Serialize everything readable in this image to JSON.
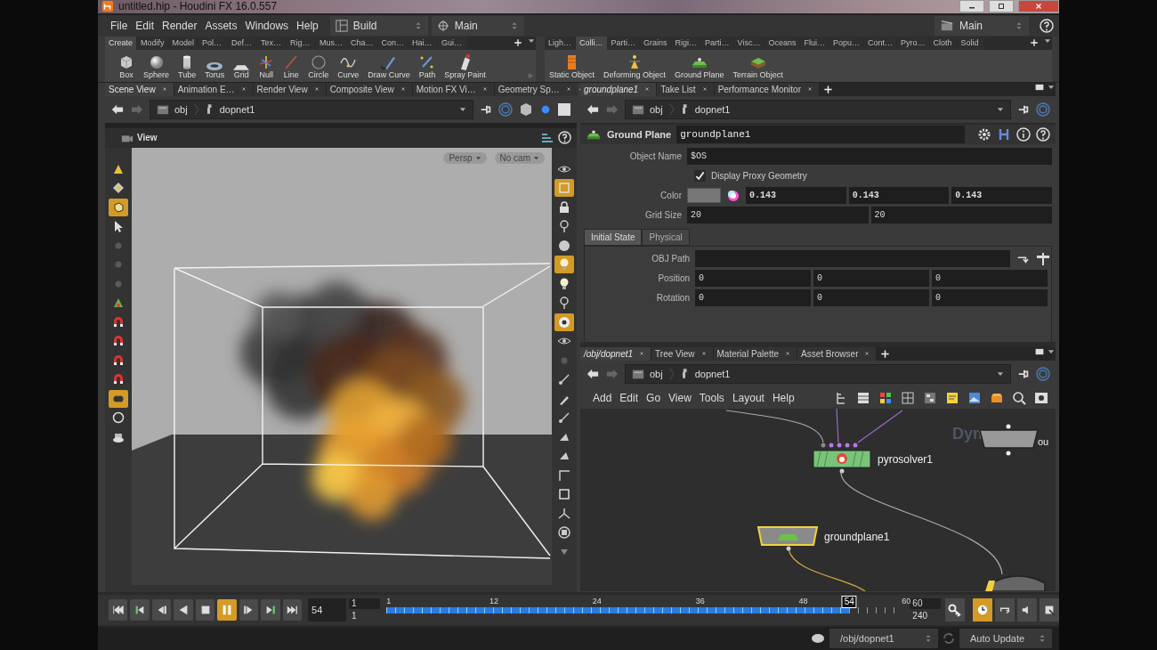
{
  "window": {
    "title": "untitled.hip - Houdini FX 16.0.557"
  },
  "menu": [
    "File",
    "Edit",
    "Render",
    "Assets",
    "Windows",
    "Help"
  ],
  "desktop": "Build",
  "viewport_layout": "Main",
  "right_layout": "Main",
  "shelf_left": {
    "tabs": [
      {
        "label": "Create",
        "selected": true
      },
      {
        "label": "Modify",
        "selected": false
      },
      {
        "label": "Model",
        "selected": false
      },
      {
        "label": "Pol…",
        "selected": false
      },
      {
        "label": "Def…",
        "selected": false
      },
      {
        "label": "Tex…",
        "selected": false
      },
      {
        "label": "Rig…",
        "selected": false
      },
      {
        "label": "Mus…",
        "selected": false
      },
      {
        "label": "Cha…",
        "selected": false
      },
      {
        "label": "Con…",
        "selected": false
      },
      {
        "label": "Hai…",
        "selected": false
      },
      {
        "label": "Gui…",
        "selected": false
      }
    ],
    "tools": [
      {
        "label": "Box",
        "kind": "box"
      },
      {
        "label": "Sphere",
        "kind": "sphere"
      },
      {
        "label": "Tube",
        "kind": "tube"
      },
      {
        "label": "Torus",
        "kind": "torus"
      },
      {
        "label": "Grid",
        "kind": "grid"
      },
      {
        "label": "Null",
        "kind": "null"
      },
      {
        "label": "Line",
        "kind": "line"
      },
      {
        "label": "Circle",
        "kind": "circle"
      },
      {
        "label": "Curve",
        "kind": "curve"
      },
      {
        "label": "Draw Curve",
        "kind": "drawcurve"
      },
      {
        "label": "Path",
        "kind": "path"
      },
      {
        "label": "Spray Paint",
        "kind": "spray"
      }
    ]
  },
  "shelf_right": {
    "tabs": [
      {
        "label": "Ligh…",
        "selected": false
      },
      {
        "label": "Colli…",
        "selected": true
      },
      {
        "label": "Parti…",
        "selected": false
      },
      {
        "label": "Grains",
        "selected": false
      },
      {
        "label": "Rigi…",
        "selected": false
      },
      {
        "label": "Parti…",
        "selected": false
      },
      {
        "label": "Visc…",
        "selected": false
      },
      {
        "label": "Oceans",
        "selected": false
      },
      {
        "label": "Flui…",
        "selected": false
      },
      {
        "label": "Popu…",
        "selected": false
      },
      {
        "label": "Cont…",
        "selected": false
      },
      {
        "label": "Pyro…",
        "selected": false
      },
      {
        "label": "Cloth",
        "selected": false
      },
      {
        "label": "Solid",
        "selected": false
      }
    ],
    "tools": [
      {
        "label": "Static Object",
        "kind": "static"
      },
      {
        "label": "Deforming Object",
        "kind": "deforming"
      },
      {
        "label": "Ground Plane",
        "kind": "ground"
      },
      {
        "label": "Terrain Object",
        "kind": "terrain"
      }
    ]
  },
  "scene_pane": {
    "tabs": [
      {
        "label": "Scene View",
        "selected": true
      },
      {
        "label": "Animation E…",
        "selected": false
      },
      {
        "label": "Render View",
        "selected": false
      },
      {
        "label": "Composite View",
        "selected": false
      },
      {
        "label": "Motion FX Vi…",
        "selected": false
      },
      {
        "label": "Geometry Sp…",
        "selected": false
      }
    ],
    "path": [
      "obj",
      "dopnet1"
    ],
    "viewer_title": "View",
    "camera_menus": [
      "Persp",
      "No cam"
    ],
    "left_tools": [
      {
        "kind": "triangle",
        "active": false
      },
      {
        "kind": "diamond",
        "active": false
      },
      {
        "kind": "cube",
        "active": true
      },
      {
        "kind": "arrow",
        "active": false
      },
      {
        "kind": "dot",
        "active": false
      },
      {
        "kind": "dot",
        "active": false
      },
      {
        "kind": "dot",
        "active": false
      },
      {
        "kind": "handle",
        "active": false
      },
      {
        "kind": "magnet",
        "active": false
      },
      {
        "kind": "magnet",
        "active": false
      },
      {
        "kind": "magnet",
        "active": false
      },
      {
        "kind": "magnet",
        "active": false
      },
      {
        "kind": "blob",
        "active": true
      },
      {
        "kind": "ring",
        "active": false
      },
      {
        "kind": "cake",
        "active": false
      }
    ],
    "right_tools": [
      {
        "kind": "eye",
        "active": false
      },
      {
        "kind": "frame",
        "active": true
      },
      {
        "kind": "lock",
        "active": false
      },
      {
        "kind": "pin",
        "active": false
      },
      {
        "kind": "sphere",
        "active": false
      },
      {
        "kind": "bulb",
        "active": true
      },
      {
        "kind": "bulb",
        "active": false
      },
      {
        "kind": "pin",
        "active": false
      },
      {
        "kind": "ball",
        "active": true
      },
      {
        "kind": "eye",
        "active": false
      },
      {
        "kind": "dot",
        "active": false
      },
      {
        "kind": "tick",
        "active": false
      },
      {
        "kind": "pen",
        "active": false
      },
      {
        "kind": "tick",
        "active": false
      },
      {
        "kind": "wedge",
        "active": false
      },
      {
        "kind": "wedge",
        "active": false
      },
      {
        "kind": "corner",
        "active": false
      },
      {
        "kind": "frame",
        "active": false
      },
      {
        "kind": "axes",
        "active": false
      },
      {
        "kind": "disk",
        "active": false
      },
      {
        "kind": "caret",
        "active": false
      }
    ]
  },
  "parameter_pane": {
    "tabs": [
      {
        "label": "groundplane1",
        "selected": true
      },
      {
        "label": "Take List",
        "selected": false
      },
      {
        "label": "Performance Monitor",
        "selected": false
      }
    ],
    "path": [
      "obj",
      "dopnet1"
    ],
    "node_type": "Ground Plane",
    "node_name": "groundplane1",
    "object_name": {
      "label": "Object Name",
      "value": "$OS"
    },
    "display_proxy": {
      "label": "Display Proxy Geometry",
      "checked": true
    },
    "color": {
      "label": "Color",
      "values": [
        "0.143",
        "0.143",
        "0.143"
      ]
    },
    "grid_size": {
      "label": "Grid Size",
      "values": [
        "20",
        "20"
      ]
    },
    "subtabs": [
      {
        "label": "Initial State",
        "selected": true
      },
      {
        "label": "Physical",
        "selected": false
      }
    ],
    "obj_path": {
      "label": "OBJ Path"
    },
    "position": {
      "label": "Position",
      "values": [
        "0",
        "0",
        "0"
      ]
    },
    "rotation": {
      "label": "Rotation",
      "values": [
        "0",
        "0",
        "0"
      ]
    }
  },
  "network_pane": {
    "tabs": [
      {
        "label": "/obj/dopnet1",
        "selected": true
      },
      {
        "label": "Tree View",
        "selected": false
      },
      {
        "label": "Material Palette",
        "selected": false
      },
      {
        "label": "Asset Browser",
        "selected": false
      }
    ],
    "path": [
      "obj",
      "dopnet1"
    ],
    "menu": [
      "Add",
      "Edit",
      "Go",
      "View",
      "Tools",
      "Layout",
      "Help"
    ],
    "network_type": "Dyn",
    "nodes": [
      {
        "kind": "solver",
        "label": "pyrosolver1",
        "selected": false
      },
      {
        "kind": "ground",
        "label": "groundplane1",
        "selected": true
      },
      {
        "kind": "object",
        "label": "ou",
        "selected": false
      },
      {
        "kind": "partial",
        "selected": false
      }
    ]
  },
  "timeline": {
    "transport": [
      {
        "kind": "first",
        "active": false
      },
      {
        "kind": "prevkey",
        "active": false
      },
      {
        "kind": "stepback",
        "active": false
      },
      {
        "kind": "reverse",
        "active": false
      },
      {
        "kind": "stop",
        "active": false
      },
      {
        "kind": "pause",
        "active": true
      },
      {
        "kind": "stepfwd",
        "active": false
      },
      {
        "kind": "nextkey",
        "active": false
      },
      {
        "kind": "last",
        "active": false
      }
    ],
    "frame": "54",
    "start": [
      "1",
      "1"
    ],
    "ticks": [
      "1",
      "12",
      "24",
      "36",
      "48",
      "60"
    ],
    "current": "54",
    "level": 0.898,
    "end": [
      "60",
      "240"
    ]
  },
  "status": {
    "path": "/obj/dopnet1",
    "update_mode": "Auto Update"
  }
}
